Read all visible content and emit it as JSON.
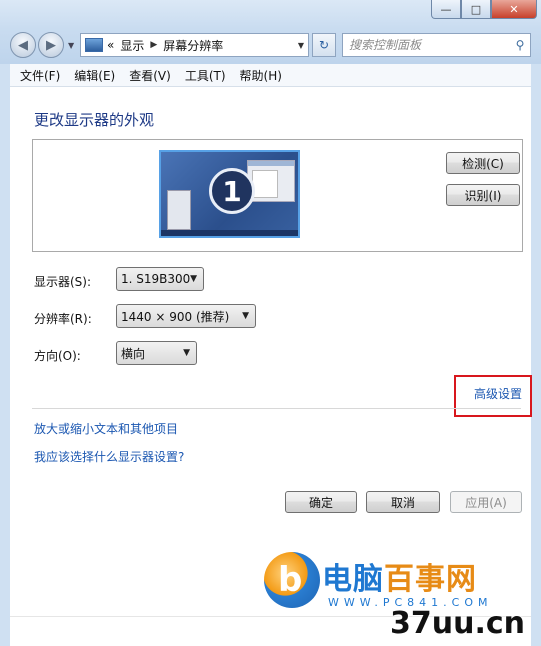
{
  "window": {
    "caption_buttons": {
      "minimize": "—",
      "maximize": "□",
      "close": "✕"
    }
  },
  "nav": {
    "back_glyph": "◀",
    "forward_glyph": "▶",
    "history_glyph": "▼"
  },
  "address": {
    "prefix": "«",
    "crumb1": "显示",
    "separator": "▶",
    "crumb2": "屏幕分辨率",
    "dropdown_glyph": "▼"
  },
  "refresh_glyph": "↻",
  "search": {
    "placeholder": "搜索控制面板",
    "icon_glyph": "⚲"
  },
  "menubar": [
    "文件(F)",
    "编辑(E)",
    "查看(V)",
    "工具(T)",
    "帮助(H)"
  ],
  "main": {
    "title": "更改显示器的外观",
    "monitor_number": "1",
    "detect_label": "检测(C)",
    "identify_label": "识别(I)",
    "display_label": "显示器(S):",
    "display_value": "1. S19B300",
    "resolution_label": "分辨率(R):",
    "resolution_value": "1440 × 900 (推荐)",
    "orientation_label": "方向(O):",
    "orientation_value": "横向",
    "advanced_link": "高级设置",
    "link_text_size": "放大或缩小文本和其他项目",
    "link_which_settings": "我应该选择什么显示器设置?",
    "ok_label": "确定",
    "cancel_label": "取消",
    "apply_label": "应用(A)"
  },
  "watermark": {
    "brand_part1": "电脑",
    "brand_part2": "百事网",
    "url": "WWW.PC841.COM",
    "logo_letter": "b",
    "site2": "37uu.cn"
  },
  "colors": {
    "title_blue": "#1e3a86",
    "link_blue": "#1b57b1",
    "highlight_red": "#d8171d"
  }
}
